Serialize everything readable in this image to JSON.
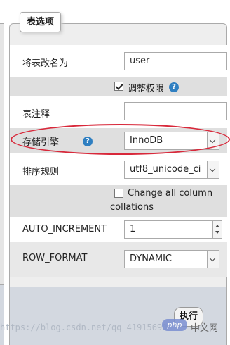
{
  "legend": "表选项",
  "fields": {
    "rename_label": "将表改名为",
    "rename_value": "user",
    "adjust_privileges_label": "调整权限",
    "comment_label": "表注释",
    "comment_value": "",
    "engine_label": "存储引擎",
    "engine_value": "InnoDB",
    "collation_label": "排序规则",
    "collation_value": "utf8_unicode_ci",
    "change_all_label_line1": "Change all column",
    "change_all_label_line2": "collations",
    "auto_increment_label": "AUTO_INCREMENT",
    "auto_increment_value": "1",
    "row_format_label": "ROW_FORMAT",
    "row_format_value": "DYNAMIC"
  },
  "help_glyph": "?",
  "checkboxes": {
    "adjust_privileges": true,
    "change_all_collations": false
  },
  "footer": {
    "execute_label": "执行"
  },
  "watermark": {
    "url": "https://blog.csdn.net/qq_41915690",
    "logo": "php",
    "cn": "中文网"
  },
  "colors": {
    "highlight": "#d8283a",
    "help": "#2f7fc1"
  }
}
